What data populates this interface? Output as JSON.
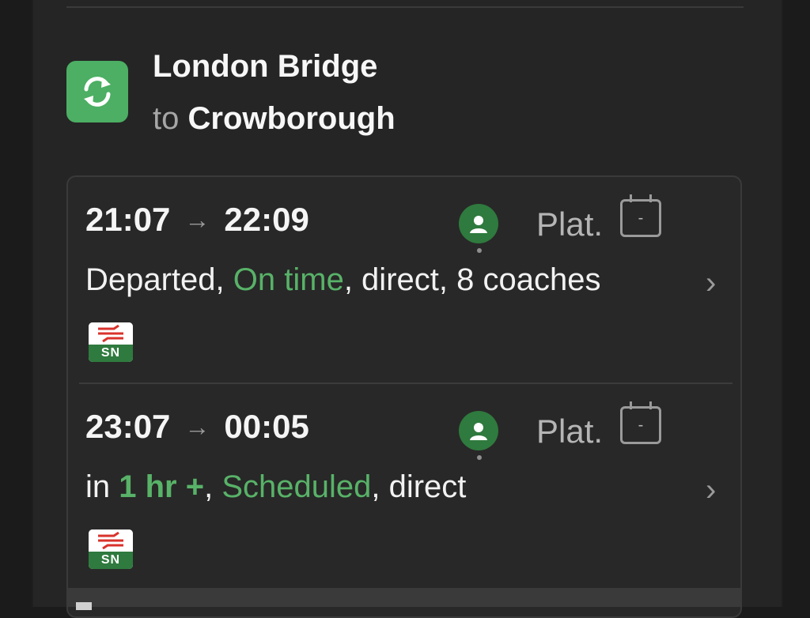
{
  "route": {
    "origin": "London Bridge",
    "to_word": "to",
    "destination": "Crowborough"
  },
  "services": [
    {
      "depart": "21:07",
      "arrive": "22:09",
      "platform_label": "Plat.",
      "platform_value": "-",
      "status_prefix": "Departed, ",
      "status_highlight": "On time",
      "status_suffix": ", direct, 8 coaches",
      "operator_code": "SN"
    },
    {
      "depart": "23:07",
      "arrive": "00:05",
      "platform_label": "Plat.",
      "platform_value": "-",
      "status_prefix": "in ",
      "status_eta": "1 hr +",
      "status_sep": ", ",
      "status_highlight": "Scheduled",
      "status_suffix": ", direct",
      "operator_code": "SN"
    }
  ],
  "arrow_glyph": "→",
  "chevron_glyph": "›",
  "colors": {
    "accent_green": "#4caf63",
    "status_green": "#58b268",
    "crowding_green": "#2f7a3e",
    "national_rail_red": "#d9322c"
  },
  "icons": {
    "route": "refresh-arrows-icon",
    "crowding": "person-icon",
    "platform": "calendar-box-icon",
    "operator": "national-rail-icon"
  }
}
